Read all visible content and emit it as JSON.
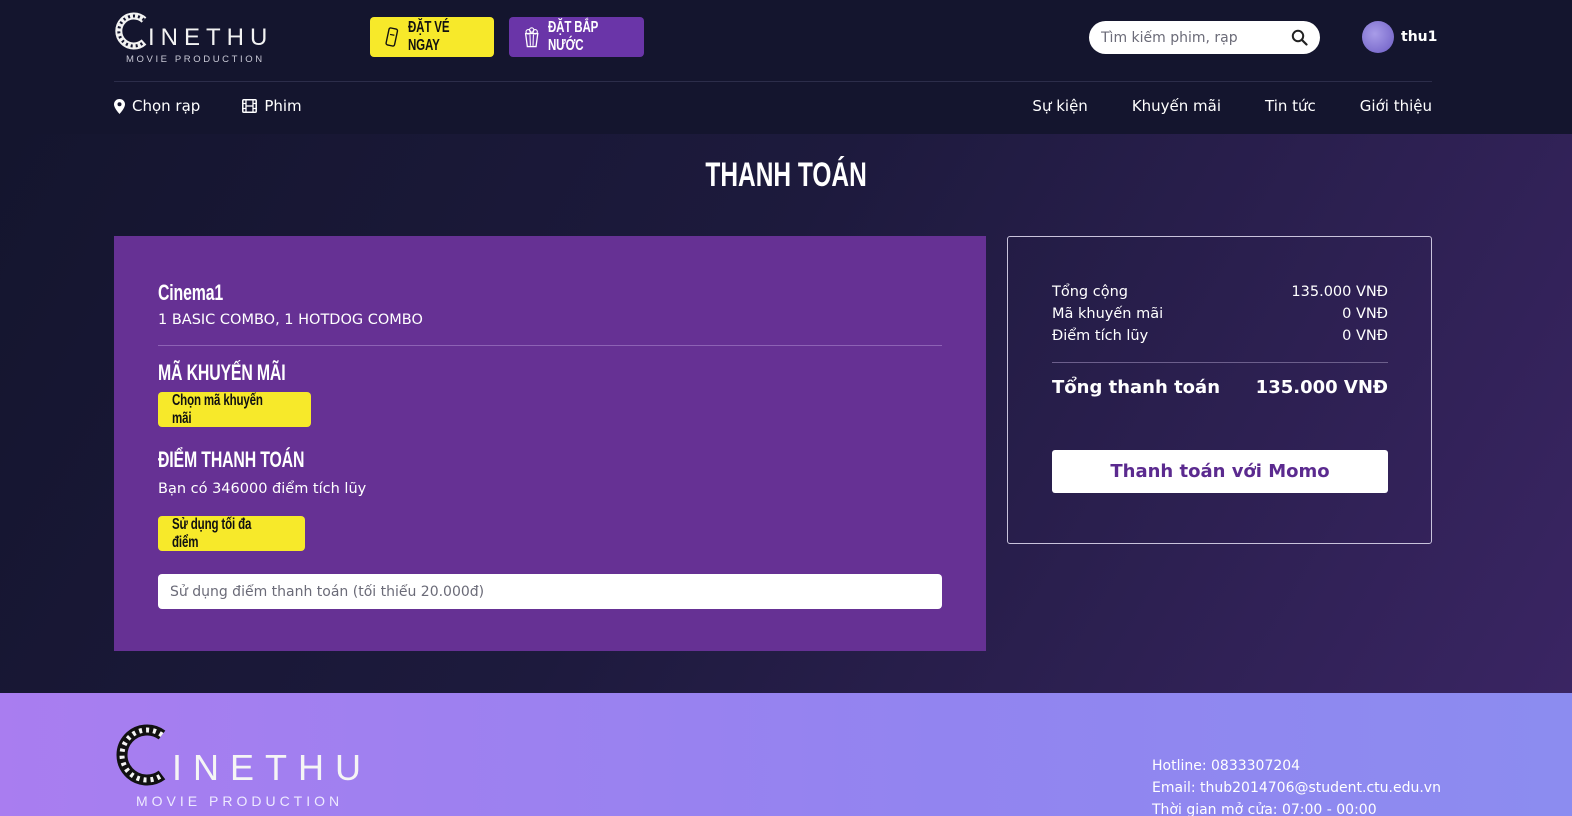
{
  "header": {
    "logo_word": "INETHU",
    "logo_sub": "MOVIE PRODUCTION",
    "book_ticket": "ĐẶT VÉ NGAY",
    "order_snacks": "ĐẶT BẮP NƯỚC",
    "search_placeholder": "Tìm kiếm phim, rạp",
    "username": "thu1"
  },
  "nav": {
    "left": [
      {
        "label": "Chọn rạp",
        "icon": "map-pin-icon"
      },
      {
        "label": "Phim",
        "icon": "film-icon"
      }
    ],
    "right": [
      "Sự kiện",
      "Khuyến mãi",
      "Tin tức",
      "Giới thiệu"
    ]
  },
  "page": {
    "title": "THANH TOÁN"
  },
  "order": {
    "cinema": "Cinema1",
    "items": "1 BASIC COMBO, 1 HOTDOG COMBO",
    "promo_heading": "MÃ KHUYẾN MÃI",
    "promo_button": "Chọn mã khuyến mãi",
    "points_heading": "ĐIỂM THANH TOÁN",
    "points_text": "Bạn có 346000 điểm tích lũy",
    "max_points_button": "Sử dụng tối đa điểm",
    "points_input_placeholder": "Sử dụng điểm thanh toán (tối thiểu 20.000đ)"
  },
  "summary": {
    "subtotal_label": "Tổng cộng",
    "subtotal_value": "135.000 VNĐ",
    "promo_label": "Mã khuyến mãi",
    "promo_value": "0 VNĐ",
    "points_label": "Điểm tích lũy",
    "points_value": "0 VNĐ",
    "total_label": "Tổng thanh toán",
    "total_value": "135.000 VNĐ",
    "pay_button": "Thanh toán với Momo"
  },
  "footer": {
    "logo_word": "INETHU",
    "logo_sub": "MOVIE PRODUCTION",
    "hotline": "Hotline: 0833307204",
    "email": "Email: thub2014706@student.ctu.edu.vn",
    "hours": "Thời gian mở cửa: 07:00 - 00:00"
  },
  "colors": {
    "page_bg": "#14152e",
    "accent_yellow": "#f7e92a",
    "accent_purple": "#663194",
    "footer_gradient_start": "#a97df0",
    "footer_gradient_end": "#8c8cf0"
  }
}
